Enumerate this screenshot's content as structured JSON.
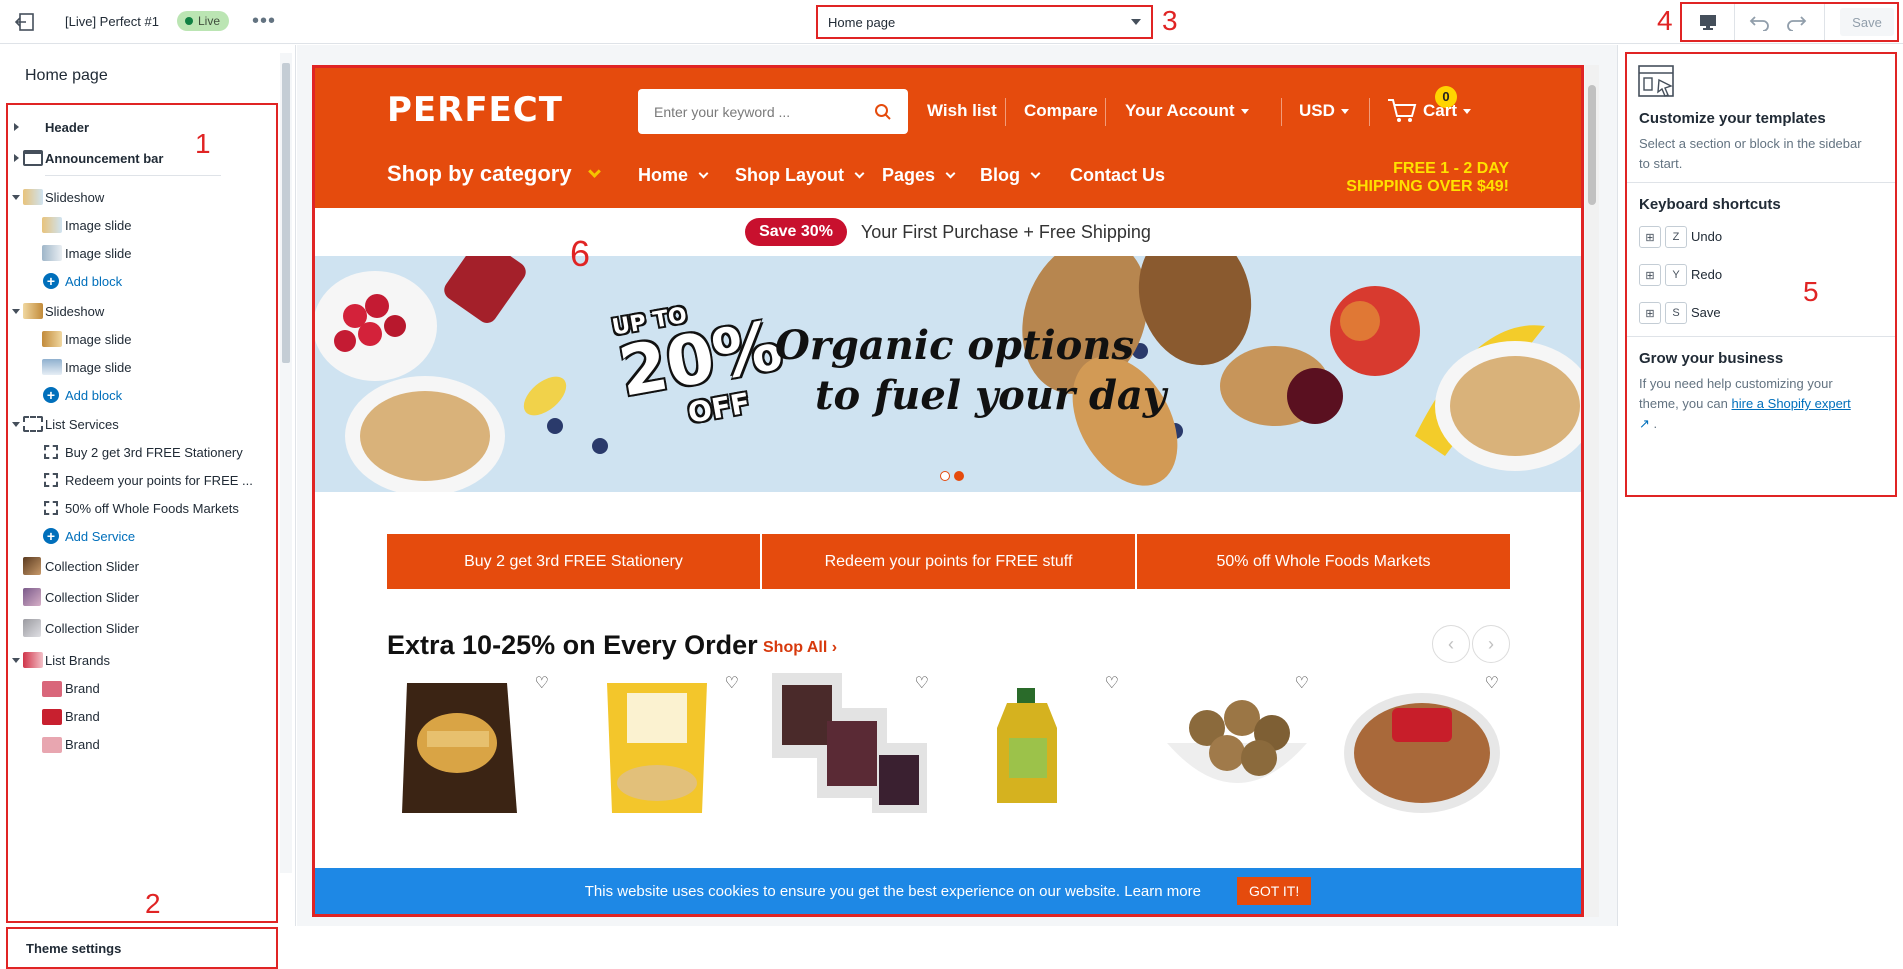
{
  "topbar": {
    "theme_name": "[Live] Perfect #1",
    "live_badge": "Live",
    "more_label": "•••",
    "page_select": "Home page",
    "save_label": "Save"
  },
  "annotations": [
    "1",
    "2",
    "3",
    "4",
    "5",
    "6"
  ],
  "sidebar": {
    "title": "Home page",
    "items": [
      {
        "label": "Header"
      },
      {
        "label": "Announcement bar"
      },
      {
        "label": "Slideshow"
      },
      {
        "label": "Image slide"
      },
      {
        "label": "Image slide"
      },
      {
        "label": "Add block"
      },
      {
        "label": "Slideshow"
      },
      {
        "label": "Image slide"
      },
      {
        "label": "Image slide"
      },
      {
        "label": "Add block"
      },
      {
        "label": "List Services"
      },
      {
        "label": "Buy 2 get 3rd FREE Stationery"
      },
      {
        "label": "Redeem your points for FREE ..."
      },
      {
        "label": "50% off Whole Foods Markets"
      },
      {
        "label": "Add Service"
      },
      {
        "label": "Collection Slider"
      },
      {
        "label": "Collection Slider"
      },
      {
        "label": "Collection Slider"
      },
      {
        "label": "List Brands"
      },
      {
        "label": "Brand"
      },
      {
        "label": "Brand"
      },
      {
        "label": "Brand"
      }
    ],
    "theme_settings": "Theme settings"
  },
  "store": {
    "logo": "PERFECT",
    "search_placeholder": "Enter your keyword ...",
    "header_links": [
      "Wish list",
      "Compare",
      "Your Account",
      "USD",
      "Cart"
    ],
    "cart_count": "0",
    "shop_by_category": "Shop by category",
    "main_nav": [
      "Home",
      "Shop Layout",
      "Pages",
      "Blog",
      "Contact Us"
    ],
    "free_ship_line1": "FREE 1 - 2 DAY",
    "free_ship_line2": "SHIPPING OVER $49!",
    "promo_badge": "Save 30%",
    "promo_text": "Your First Purchase + Free Shipping",
    "banner_upto": "UP TO",
    "banner_pct": "20%",
    "banner_off": "OFF",
    "banner_line1": "Organic options",
    "banner_line2": "to fuel your day",
    "services": [
      "Buy 2 get 3rd FREE Stationery",
      "Redeem your points for FREE stuff",
      "50% off Whole Foods Markets"
    ],
    "section_title": "Extra 10-25% on Every Order",
    "shop_all": "Shop All",
    "cookie_text": "This website uses cookies to ensure you get the best experience on our website. Learn more",
    "cookie_button": "GOT IT!"
  },
  "right_panel": {
    "customize_title": "Customize your templates",
    "customize_text": "Select a section or block in the sidebar to start.",
    "shortcuts_title": "Keyboard shortcuts",
    "shortcuts": [
      {
        "key": "Z",
        "label": "Undo"
      },
      {
        "key": "Y",
        "label": "Redo"
      },
      {
        "key": "S",
        "label": "Save"
      }
    ],
    "grow_title": "Grow your business",
    "grow_text": "If you need help customizing your theme, you can",
    "grow_link": "hire a Shopify expert",
    "grow_end": "."
  },
  "colors": {
    "brand_orange": "#e54b0d",
    "annotation_red": "#e02424",
    "cookie_blue": "#1e88e5",
    "link_blue": "#006fbb"
  }
}
